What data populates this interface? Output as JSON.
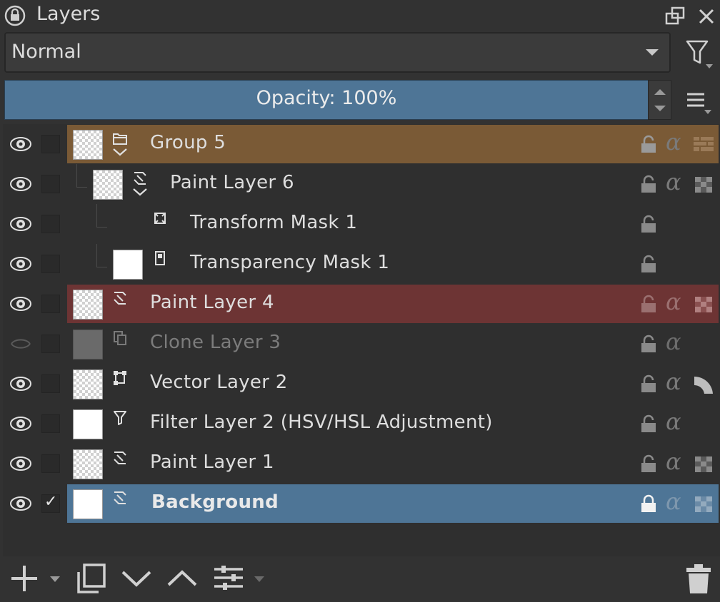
{
  "panel": {
    "title": "Layers"
  },
  "blend_mode": {
    "value": "Normal"
  },
  "opacity": {
    "label": "Opacity: 100%",
    "value_percent": 100
  },
  "layers": [
    {
      "name": "Group 5",
      "type": "group"
    },
    {
      "name": "Paint Layer 6",
      "type": "paint"
    },
    {
      "name": "Transform Mask 1",
      "type": "transform-mask"
    },
    {
      "name": "Transparency Mask 1",
      "type": "transparency-mask"
    },
    {
      "name": "Paint Layer 4",
      "type": "paint"
    },
    {
      "name": "Clone Layer 3",
      "type": "clone"
    },
    {
      "name": "Vector Layer 2",
      "type": "vector"
    },
    {
      "name": "Filter Layer 2 (HSV/HSL Adjustment)",
      "type": "filter"
    },
    {
      "name": "Paint Layer 1",
      "type": "paint"
    },
    {
      "name": "Background",
      "type": "paint",
      "selected": true,
      "locked": true
    }
  ],
  "colors": {
    "group_label": "#7a5a36",
    "red_label": "#6d3434",
    "selected": "#4e7596",
    "panel_bg": "#323232"
  },
  "icons": [
    "lock-icon",
    "float-icon",
    "close-icon",
    "filter-icon",
    "menu-icon",
    "eye-icon",
    "alpha-icon",
    "add-icon",
    "duplicate-icon",
    "move-down-icon",
    "move-up-icon",
    "properties-icon",
    "trash-icon"
  ]
}
